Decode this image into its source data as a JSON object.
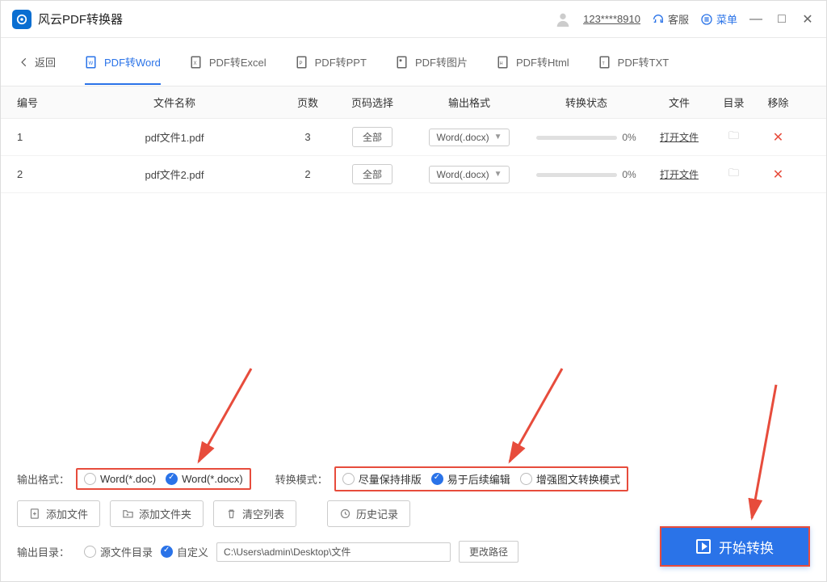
{
  "app": {
    "title": "风云PDF转换器"
  },
  "titlebar": {
    "user_id": "123****8910",
    "service_label": "客服",
    "menu_label": "菜单"
  },
  "tabs": {
    "back_label": "返回",
    "items": [
      {
        "label": "PDF转Word",
        "active": true
      },
      {
        "label": "PDF转Excel"
      },
      {
        "label": "PDF转PPT"
      },
      {
        "label": "PDF转图片"
      },
      {
        "label": "PDF转Html"
      },
      {
        "label": "PDF转TXT"
      }
    ]
  },
  "table": {
    "headers": {
      "id": "编号",
      "name": "文件名称",
      "pages": "页数",
      "pagesel": "页码选择",
      "format": "输出格式",
      "status": "转换状态",
      "file": "文件",
      "dir": "目录",
      "remove": "移除"
    },
    "rows": [
      {
        "id": "1",
        "name": "pdf文件1.pdf",
        "pages": "3",
        "pagesel": "全部",
        "format": "Word(.docx)",
        "progress": "0%",
        "open": "打开文件"
      },
      {
        "id": "2",
        "name": "pdf文件2.pdf",
        "pages": "2",
        "pagesel": "全部",
        "format": "Word(.docx)",
        "progress": "0%",
        "open": "打开文件"
      }
    ]
  },
  "output_format": {
    "label": "输出格式：",
    "options": [
      {
        "label": "Word(*.doc)",
        "checked": false
      },
      {
        "label": "Word(*.docx)",
        "checked": true
      }
    ]
  },
  "convert_mode": {
    "label": "转换模式：",
    "options": [
      {
        "label": "尽量保持排版",
        "checked": false
      },
      {
        "label": "易于后续编辑",
        "checked": true
      },
      {
        "label": "增强图文转换模式",
        "checked": false
      }
    ]
  },
  "actions": {
    "add_file": "添加文件",
    "add_folder": "添加文件夹",
    "clear_list": "清空列表",
    "history": "历史记录"
  },
  "output_dir": {
    "label": "输出目录：",
    "source_option": "源文件目录",
    "custom_option": "自定义",
    "path": "C:\\Users\\admin\\Desktop\\文件",
    "change_btn": "更改路径"
  },
  "start": {
    "label": "开始转换"
  }
}
